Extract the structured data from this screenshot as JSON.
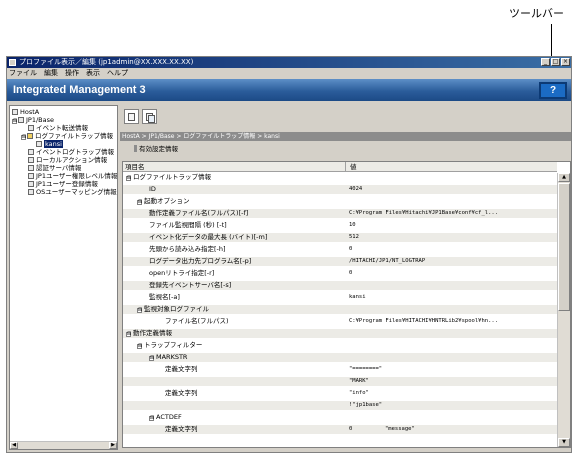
{
  "callout": {
    "label": "ツールバー"
  },
  "window": {
    "title": "プロファイル表示／編集 (jp1admin@XX.XXX.XX.XX)",
    "win_buttons": [
      "_",
      "□",
      "×"
    ]
  },
  "menubar": [
    "ファイル",
    "編集",
    "操作",
    "表示",
    "ヘルプ"
  ],
  "banner": {
    "title": "Integrated Management 3",
    "help_label": "?"
  },
  "tree": {
    "items": [
      {
        "label": "HostA",
        "indent": 0,
        "expander": ""
      },
      {
        "label": "JP1/Base",
        "indent": 1,
        "expander": "⊟"
      },
      {
        "label": "イベント転送情報",
        "indent": 2,
        "expander": ""
      },
      {
        "label": "ログファイルトラップ情報",
        "indent": 2,
        "expander": "⊟"
      },
      {
        "label": "kansi",
        "indent": 3,
        "expander": "",
        "selected": true
      },
      {
        "label": "イベントログトラップ情報",
        "indent": 2,
        "expander": ""
      },
      {
        "label": "ローカルアクション情報",
        "indent": 2,
        "expander": ""
      },
      {
        "label": "認証サーバ情報",
        "indent": 2,
        "expander": ""
      },
      {
        "label": "JP1ユーザー権限レベル情報",
        "indent": 2,
        "expander": ""
      },
      {
        "label": "JP1ユーザー登録情報",
        "indent": 2,
        "expander": ""
      },
      {
        "label": "OSユーザーマッピング情報",
        "indent": 2,
        "expander": ""
      }
    ],
    "scroll_left": "◀",
    "scroll_right": "▶"
  },
  "toolbar": {
    "buttons": [
      "edit-icon",
      "copy-icon"
    ]
  },
  "breadcrumb": "HostA > JP1/Base > ログファイルトラップ情報 > kansi",
  "section_title": "有効設定情報",
  "table": {
    "headers": {
      "name": "項目名",
      "value": "値"
    },
    "rows": [
      {
        "key": "ログファイルトラップ情報",
        "level": 0,
        "expander": "⊟",
        "value": ""
      },
      {
        "key": "ID",
        "level": 2,
        "expander": "",
        "value": "4024"
      },
      {
        "key": "起動オプション",
        "level": 1,
        "expander": "⊟",
        "value": ""
      },
      {
        "key": "動作定義ファイル名(フルパス)[-f]",
        "level": 2,
        "expander": "",
        "value": "C:¥Program Files¥Hitachi¥JP1Base¥conf¥cf_l..."
      },
      {
        "key": "ファイル監視間隔 (秒) [-t]",
        "level": 2,
        "expander": "",
        "value": "10"
      },
      {
        "key": "イベント化データの最大長 (バイト)[-m]",
        "level": 2,
        "expander": "",
        "value": "512"
      },
      {
        "key": "先頭から読み込み指定[-h]",
        "level": 2,
        "expander": "",
        "value": "0"
      },
      {
        "key": "ログデータ出力先プログラム名[-p]",
        "level": 2,
        "expander": "",
        "value": "/HITACHI/JP1/NT_LOGTRAP"
      },
      {
        "key": "openリトライ指定[-r]",
        "level": 2,
        "expander": "",
        "value": "0"
      },
      {
        "key": "登録先イベントサーバ名[-s]",
        "level": 2,
        "expander": "",
        "value": ""
      },
      {
        "key": "監視名[-a]",
        "level": 2,
        "expander": "",
        "value": "kansi"
      },
      {
        "key": "監視対象ログファイル",
        "level": 1,
        "expander": "⊟",
        "value": ""
      },
      {
        "key": "ファイル名(フルパス)",
        "level": 3,
        "expander": "",
        "value": "C:¥Program Files¥HITACHI¥HNTRLib2¥spool¥hn..."
      },
      {
        "key": "動作定義情報",
        "level": 0,
        "expander": "⊟",
        "value": ""
      },
      {
        "key": "トラップフィルター",
        "level": 1,
        "expander": "⊟",
        "value": ""
      },
      {
        "key": "MARKSTR",
        "level": 2,
        "expander": "⊟",
        "value": ""
      },
      {
        "key": "定義文字列",
        "level": 3,
        "expander": "",
        "value": "\"========\""
      },
      {
        "key": "",
        "level": 3,
        "expander": "",
        "value": "\"MARK\""
      },
      {
        "key": "定義文字列",
        "level": 3,
        "expander": "",
        "value": "\"info\""
      },
      {
        "key": "",
        "level": 3,
        "expander": "",
        "value": "!\"jp1base\""
      },
      {
        "key": "ACTDEF",
        "level": 2,
        "expander": "⊟",
        "value": ""
      },
      {
        "key": "定義文字列",
        "level": 3,
        "expander": "",
        "value": "0",
        "value2": "\"message\""
      }
    ],
    "scroll_up": "▲",
    "scroll_down": "▼"
  }
}
